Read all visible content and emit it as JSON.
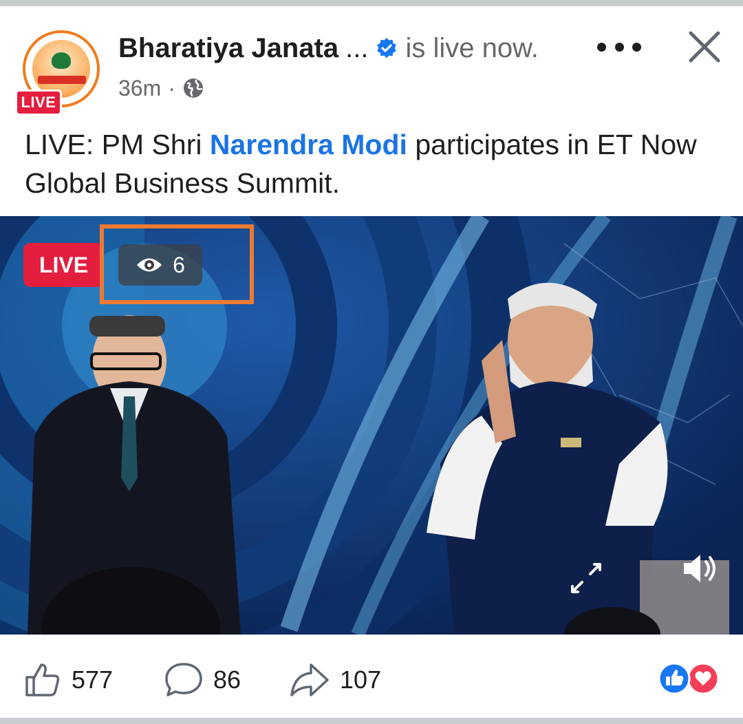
{
  "post": {
    "page_name": "Bharatiya Janata",
    "name_truncation": "...",
    "status_text": "is live now.",
    "timestamp": "36m",
    "separator": "·",
    "privacy_icon": "globe-icon",
    "avatar_live_label": "LIVE",
    "text_before": "LIVE: PM Shri ",
    "mention": "Narendra Modi",
    "text_after": " participates in ET Now Global Business Summit."
  },
  "video": {
    "live_label": "LIVE",
    "viewer_count": "6",
    "viewer_icon": "eye-icon",
    "expand_icon": "expand-icon",
    "volume_icon": "volume-icon"
  },
  "actions": {
    "like_count": "577",
    "comment_count": "86",
    "share_count": "107",
    "reaction_icons": [
      "like-reaction-icon",
      "love-reaction-icon"
    ]
  },
  "colors": {
    "live_red": "#e41e3f",
    "mention_blue": "#1b74e4",
    "highlight_orange": "#ee7a33",
    "verified_blue": "#1877f2",
    "secondary_text": "#65676b"
  }
}
